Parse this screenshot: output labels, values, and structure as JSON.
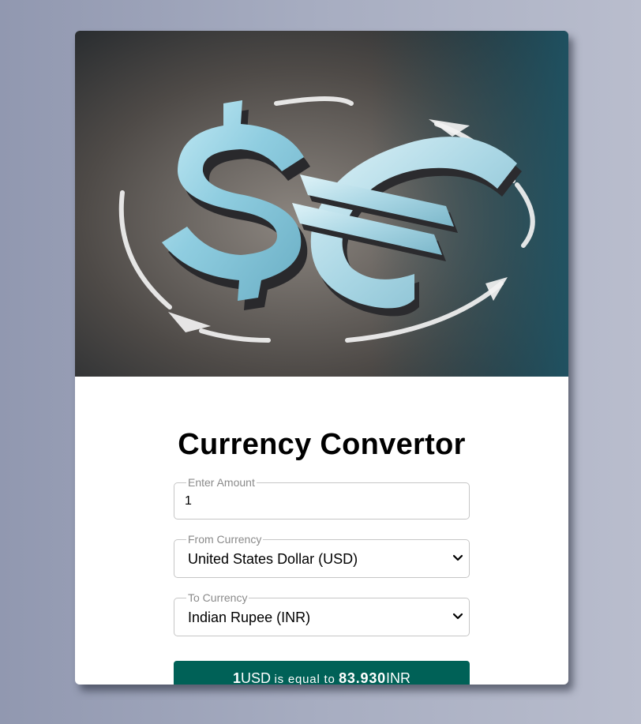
{
  "app": {
    "title": "Currency Convertor",
    "accent_color": "#006157",
    "hero_image": "dollar-euro-exchange-image"
  },
  "form": {
    "amount": {
      "label": "Enter Amount",
      "value": "1"
    },
    "from_currency": {
      "label": "From Currency",
      "selected": "United States Dollar (USD)"
    },
    "to_currency": {
      "label": "To Currency",
      "selected": "Indian Rupee (INR)"
    }
  },
  "result": {
    "amount": "1",
    "from_code": "USD",
    "middle_text": "is equal to",
    "converted_value": "83.930",
    "to_code": "INR"
  }
}
